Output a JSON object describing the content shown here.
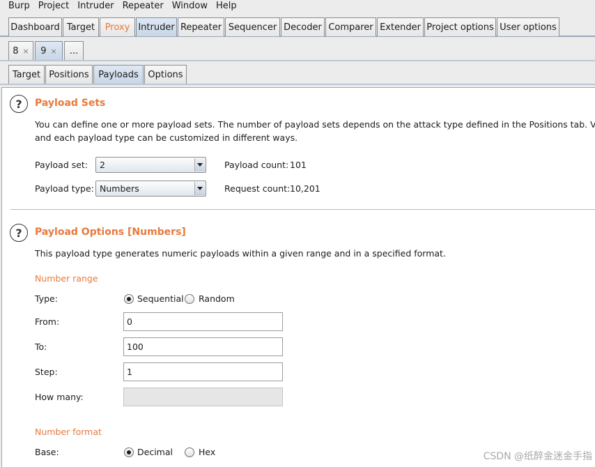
{
  "menu": [
    "Burp",
    "Project",
    "Intruder",
    "Repeater",
    "Window",
    "Help"
  ],
  "main_tabs": [
    "Dashboard",
    "Target",
    "Proxy",
    "Intruder",
    "Repeater",
    "Sequencer",
    "Decoder",
    "Comparer",
    "Extender",
    "Project options",
    "User options"
  ],
  "instance_tabs": [
    {
      "label": "8",
      "close": "×"
    },
    {
      "label": "9",
      "close": "×"
    },
    {
      "label": "..."
    }
  ],
  "sub_tabs": [
    "Target",
    "Positions",
    "Payloads",
    "Options"
  ],
  "payload_sets": {
    "help_glyph": "?",
    "title": "Payload Sets",
    "desc_line1": "You can define one or more payload sets. The number of payload sets depends on the attack type defined in the Positions tab. Various pay",
    "desc_line2": "and each payload type can be customized in different ways.",
    "set_label": "Payload set:",
    "set_value": "2",
    "type_label": "Payload type:",
    "type_value": "Numbers",
    "count_label": "Payload count:",
    "count_value": "101",
    "request_label": "Request count:",
    "request_value": "10,201"
  },
  "payload_options": {
    "help_glyph": "?",
    "title": "Payload Options [Numbers]",
    "desc": "This payload type generates numeric payloads within a given range and in a specified format.",
    "number_range": "Number range",
    "type_label": "Type:",
    "sequential": "Sequential",
    "random": "Random",
    "from_label": "From:",
    "from_value": "0",
    "to_label": "To:",
    "to_value": "100",
    "step_label": "Step:",
    "step_value": "1",
    "how_many_label": "How many:",
    "number_format": "Number format",
    "base_label": "Base:",
    "decimal": "Decimal",
    "hex": "Hex"
  },
  "watermark": "CSDN @纸醉金迷金手指",
  "colors": {
    "accent": "#e8793c",
    "active_tab": "#c9d6e6"
  }
}
